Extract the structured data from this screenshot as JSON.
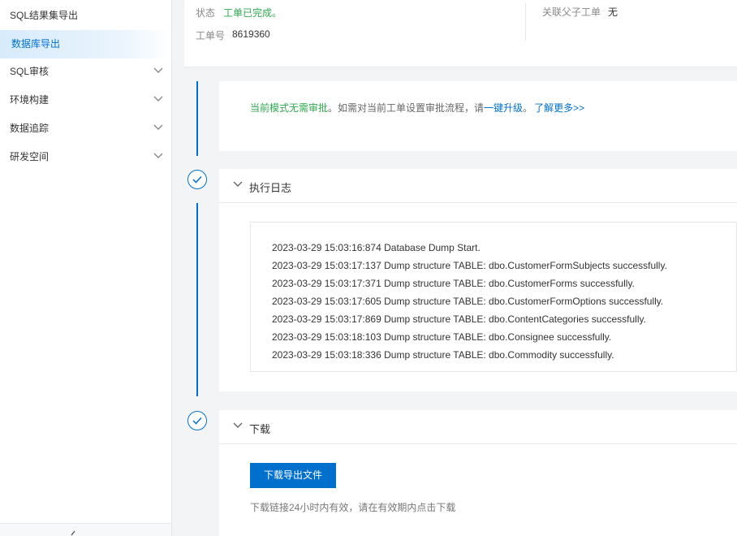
{
  "sidebar": {
    "items": [
      {
        "label": "SQL结果集导出",
        "active": false
      },
      {
        "label": "数据库导出",
        "active": true
      }
    ],
    "groups": [
      {
        "label": "SQL审核"
      },
      {
        "label": "环境构建"
      },
      {
        "label": "数据追踪"
      },
      {
        "label": "研发空间"
      }
    ]
  },
  "header": {
    "status_label": "状态",
    "status_value": "工单已完成。",
    "ticket_label": "工单号",
    "ticket_value": "8619360",
    "parent_label": "关联父子工单",
    "parent_value": "无"
  },
  "approval": {
    "notice_green": "当前模式无需审批",
    "notice_mid": "。如需对当前工单设置审批流程，请",
    "notice_upgrade": "一键升级",
    "notice_dot": "。",
    "notice_more": "了解更多>>"
  },
  "exec_log": {
    "title": "执行日志",
    "lines": [
      "2023-03-29 15:03:16:874 Database Dump Start.",
      "2023-03-29 15:03:17:137 Dump structure TABLE: dbo.CustomerFormSubjects successfully.",
      "2023-03-29 15:03:17:371 Dump structure TABLE: dbo.CustomerForms successfully.",
      "2023-03-29 15:03:17:605 Dump structure TABLE: dbo.CustomerFormOptions successfully.",
      "2023-03-29 15:03:17:869 Dump structure TABLE: dbo.ContentCategories successfully.",
      "2023-03-29 15:03:18:103 Dump structure TABLE: dbo.Consignee successfully.",
      "2023-03-29 15:03:18:336 Dump structure TABLE: dbo.Commodity successfully."
    ]
  },
  "download": {
    "title": "下载",
    "button_label": "下载导出文件",
    "hint": "下载链接24小时内有效，请在有效期内点击下载"
  },
  "colors": {
    "accent": "#0070cc",
    "success": "#2fa84f"
  }
}
